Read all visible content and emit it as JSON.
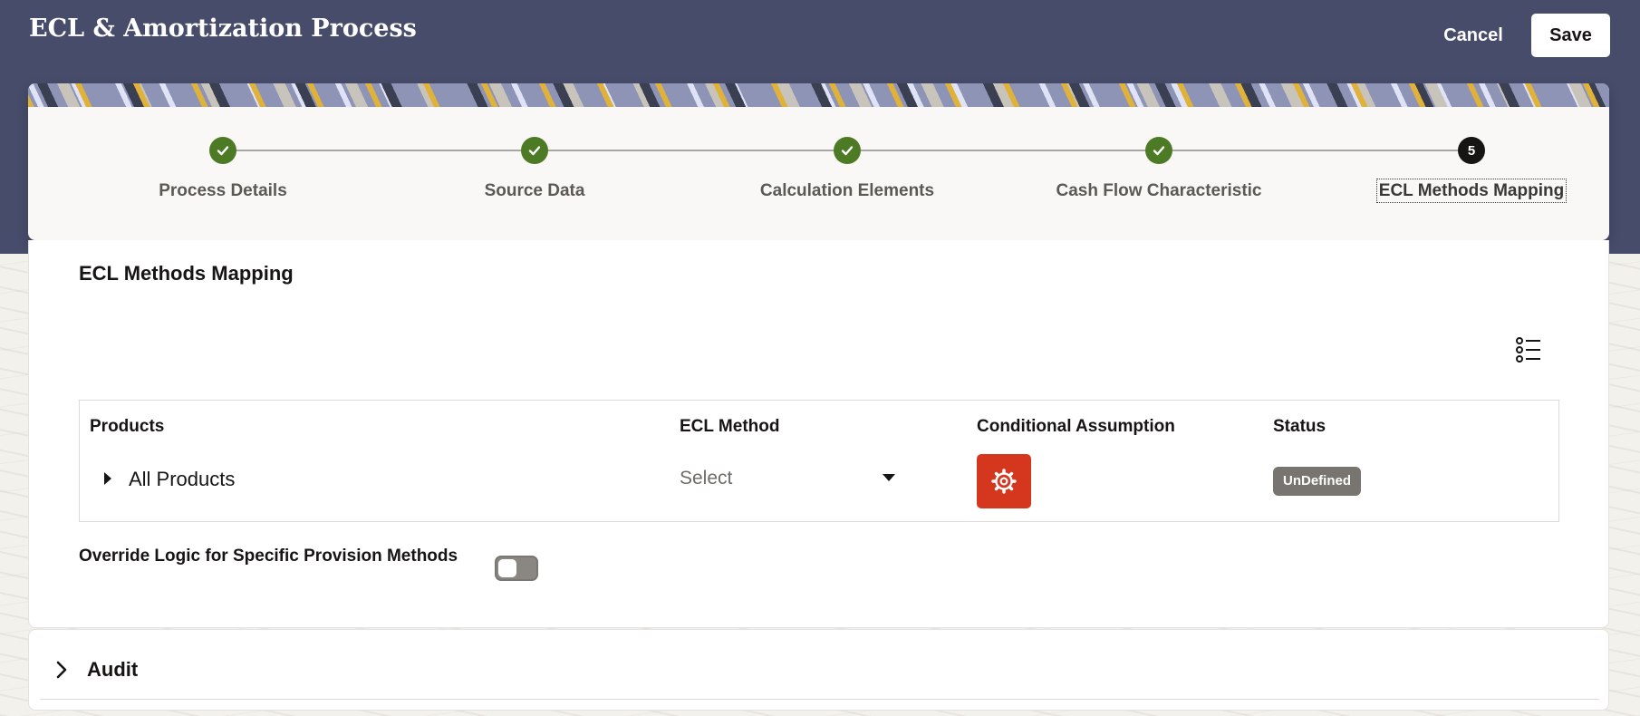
{
  "header": {
    "title": "ECL & Amortization Process",
    "cancel_label": "Cancel",
    "save_label": "Save"
  },
  "train": {
    "steps": [
      {
        "label": "Process Details",
        "state": "complete",
        "icon": "check-icon"
      },
      {
        "label": "Source Data",
        "state": "complete",
        "icon": "check-icon"
      },
      {
        "label": "Calculation Elements",
        "state": "complete",
        "icon": "check-icon"
      },
      {
        "label": "Cash Flow Characteristic",
        "state": "complete",
        "icon": "check-icon"
      },
      {
        "label": "ECL Methods Mapping",
        "state": "current",
        "number": "5"
      }
    ]
  },
  "section": {
    "title": "ECL Methods Mapping",
    "list_icon": "list-icon"
  },
  "table": {
    "columns": [
      "Products",
      "ECL Method",
      "Conditional Assumption",
      "Status"
    ],
    "rows": [
      {
        "product": "All Products",
        "ecl_method": "Select",
        "conditional_icon": "gear-icon",
        "status": "UnDefined"
      }
    ]
  },
  "override": {
    "label": "Override Logic for Specific Provision Methods",
    "enabled": false
  },
  "audit": {
    "title": "Audit"
  },
  "colors": {
    "header_bg": "#474c6b",
    "step_complete": "#4d7a25",
    "step_current": "#161513",
    "gear_button": "#d4361e",
    "status_badge": "#787470"
  }
}
